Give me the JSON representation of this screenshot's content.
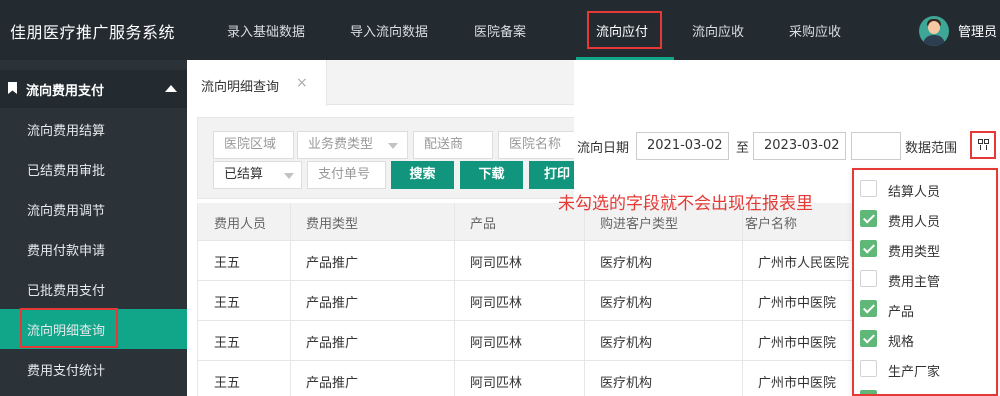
{
  "app_title": "佳朋医疗推广服务系统",
  "nav": {
    "items": [
      "录入基础数据",
      "导入流向数据",
      "医院备案"
    ],
    "right_items": [
      "流向应收",
      "采购应收"
    ],
    "active": "流向应付",
    "user": "管理员"
  },
  "sidebar": {
    "header": "流向费用支付",
    "items": [
      {
        "label": "流向费用结算"
      },
      {
        "label": "已结费用审批"
      },
      {
        "label": "流向费用调节"
      },
      {
        "label": "费用付款申请"
      },
      {
        "label": "已批费用支付"
      },
      {
        "label": "流向明细查询"
      },
      {
        "label": "费用支付统计"
      }
    ],
    "active_index": 5
  },
  "tab": {
    "label": "流向明细查询",
    "close": "×"
  },
  "filters": {
    "area_placeholder": "医院区域",
    "type_placeholder": "业务费类型",
    "distributor_placeholder": "配送商",
    "hospital_placeholder": "医院名称",
    "status_value": "已结算",
    "pay_no_placeholder": "支付单号",
    "search_label": "搜索",
    "download_label": "下载",
    "print_label": "打印"
  },
  "table": {
    "headers": [
      "费用人员",
      "费用类型",
      "产品",
      "购进客户类型",
      "客户名称"
    ],
    "rows": [
      [
        "王五",
        "产品推广",
        "阿司匹林",
        "医疗机构",
        "广州市人民医院"
      ],
      [
        "王五",
        "产品推广",
        "阿司匹林",
        "医疗机构",
        "广州市中医院"
      ],
      [
        "王五",
        "产品推广",
        "阿司匹林",
        "医疗机构",
        "广州市中医院"
      ],
      [
        "王五",
        "产品推广",
        "阿司匹林",
        "医疗机构",
        "广州市中医院"
      ]
    ]
  },
  "date_filter": {
    "label": "流向日期",
    "start": "2021-03-02",
    "to": "至",
    "end": "2023-03-02",
    "scope_label": "数据范围"
  },
  "annotation": "未勾选的字段就不会出现在报表里",
  "columns_menu": [
    {
      "label": "结算人员",
      "checked": false
    },
    {
      "label": "费用人员",
      "checked": true
    },
    {
      "label": "费用类型",
      "checked": true
    },
    {
      "label": "费用主管",
      "checked": false
    },
    {
      "label": "产品",
      "checked": true
    },
    {
      "label": "规格",
      "checked": true
    },
    {
      "label": "生产厂家",
      "checked": false
    },
    {
      "label": "",
      "checked": true
    }
  ],
  "colors": {
    "accent": "#11a58a",
    "header_bg": "#232a30",
    "sidebar_bg": "#2b3238",
    "highlight": "#e53935"
  }
}
